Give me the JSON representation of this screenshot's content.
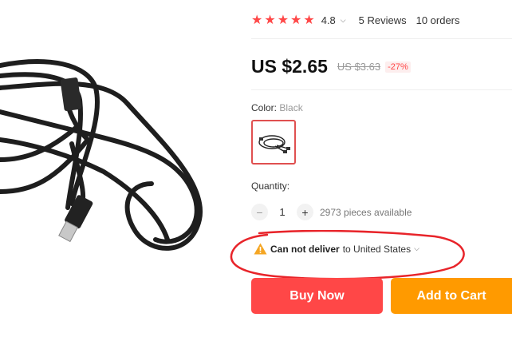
{
  "product": {
    "rating": "4.8",
    "reviews": "5 Reviews",
    "orders": "10 orders",
    "price": "US $2.65",
    "old_price": "US $3.63",
    "discount": "-27%",
    "color_label": "Color:",
    "color_value": "Black",
    "quantity_label": "Quantity:",
    "quantity_value": "1",
    "minus_symbol": "−",
    "plus_symbol": "+",
    "available": "2973 pieces available",
    "delivery_status": "Can not deliver",
    "delivery_destination": "to United States",
    "buy_now_label": "Buy Now",
    "add_to_cart_label": "Add to Cart"
  },
  "colors": {
    "accent_red": "#ff4747",
    "cart_orange": "#ff9a00",
    "annotation_red": "#e8242a"
  },
  "icons": {
    "star": "star-icon",
    "warning": "warning-icon",
    "chevron": "chevron-down-icon"
  }
}
